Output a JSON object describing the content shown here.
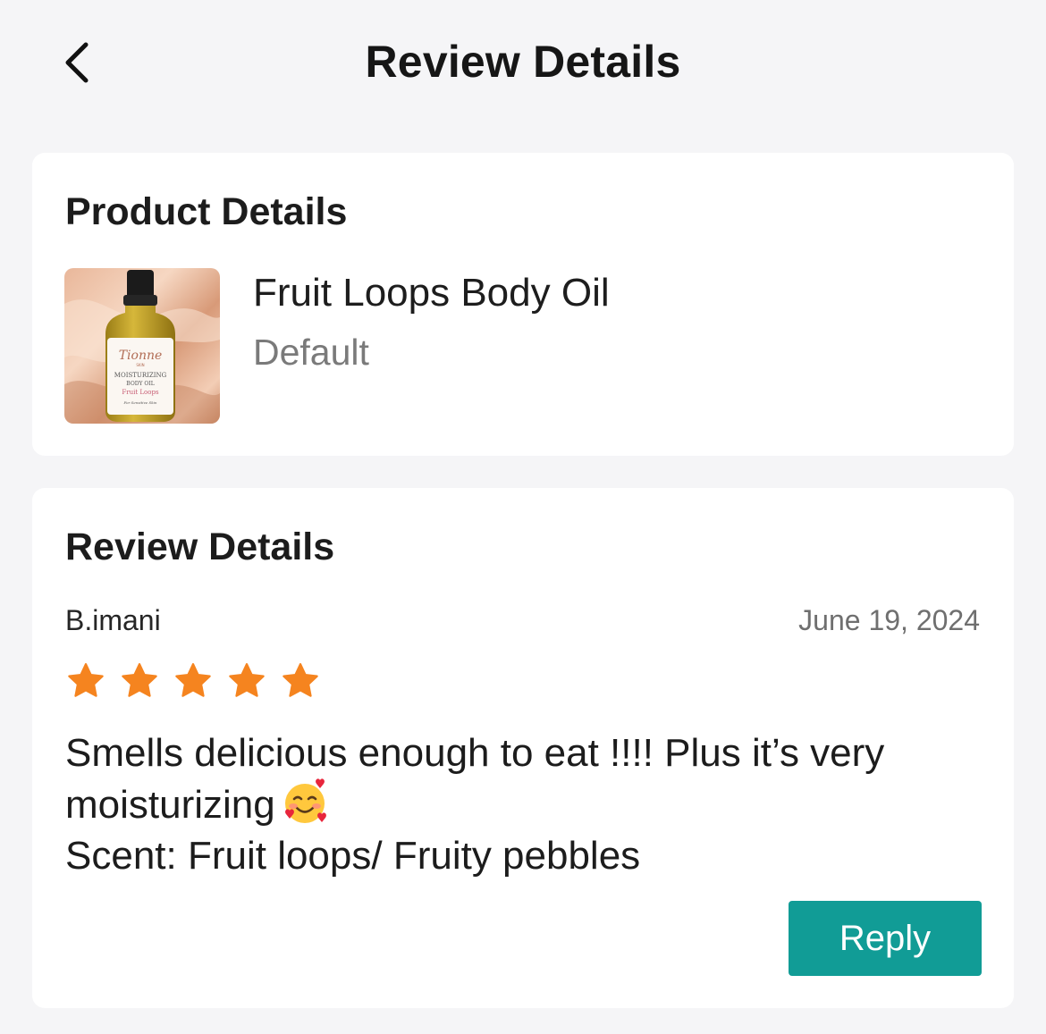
{
  "header": {
    "title": "Review Details",
    "back_icon": "chevron-left-icon"
  },
  "product_card": {
    "title": "Product Details",
    "product": {
      "name": "Fruit Loops Body Oil",
      "variant": "Default",
      "image_label": {
        "brand": "Tionne",
        "brand_sub": "SKIN",
        "line1": "MOISTURIZING",
        "line2": "BODY OIL",
        "line3": "Fruit Loops",
        "line4": "For Sensitive Skin"
      }
    }
  },
  "review_card": {
    "title": "Review Details",
    "reviewer": "B.imani",
    "date": "June 19, 2024",
    "rating": 5,
    "max_rating": 5,
    "star_color": "#f5841f",
    "text_line1": "Smells delicious enough to eat !!!! Plus it’s very",
    "text_line2": "moisturizing",
    "text_line3": "Scent: Fruit loops/ Fruity pebbles",
    "emoji_icon": "smiling-face-with-hearts-icon",
    "reply_label": "Reply"
  },
  "colors": {
    "background": "#f5f5f7",
    "card": "#ffffff",
    "accent": "#119c96",
    "muted_text": "#7a7a7a"
  }
}
